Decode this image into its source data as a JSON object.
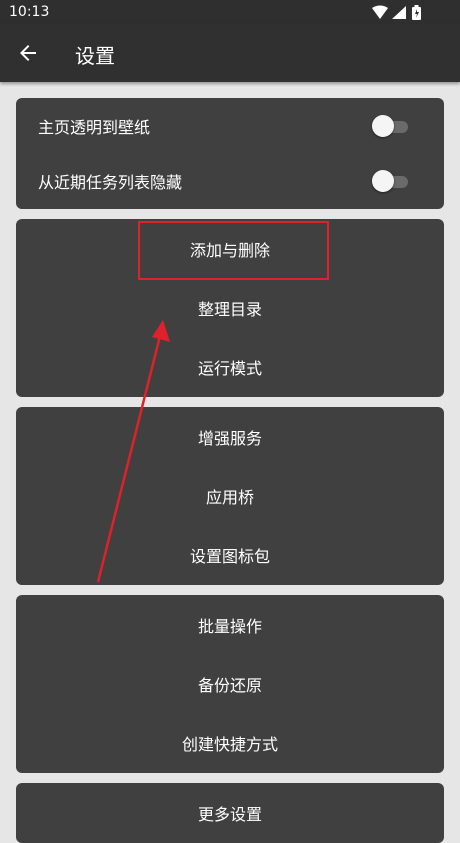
{
  "status_bar": {
    "time": "10:13"
  },
  "app_bar": {
    "title": "设置"
  },
  "toggles": [
    {
      "label": "主页透明到壁纸",
      "on": false
    },
    {
      "label": "从近期任务列表隐藏",
      "on": false
    }
  ],
  "group1": [
    "添加与删除",
    "整理目录",
    "运行模式"
  ],
  "group2": [
    "增强服务",
    "应用桥",
    "设置图标包"
  ],
  "group3": [
    "批量操作",
    "备份还原",
    "创建快捷方式"
  ],
  "group4": [
    "更多设置"
  ],
  "colors": {
    "annotation": "#e0202a"
  }
}
